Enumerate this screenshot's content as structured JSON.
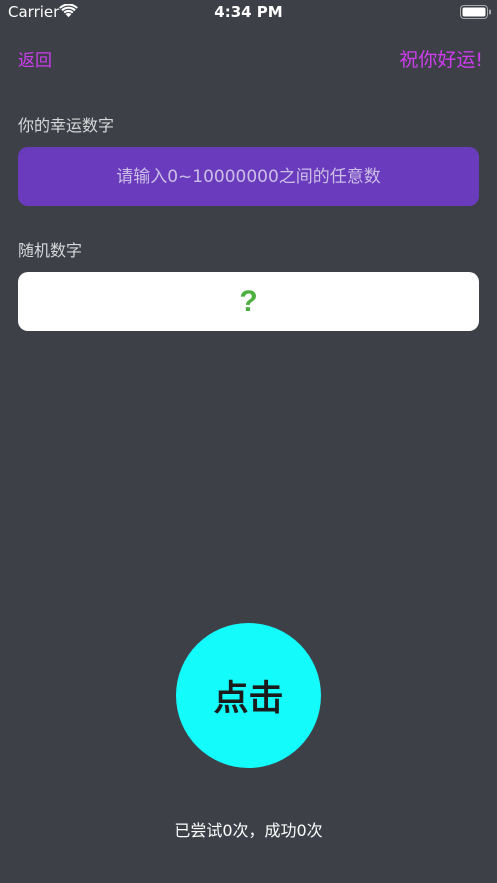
{
  "status_bar": {
    "carrier": "Carrier",
    "time": "4:34 PM",
    "wifi_icon": "wifi-icon",
    "battery_icon": "battery-icon"
  },
  "nav": {
    "back_label": "返回",
    "title": "祝你好运!"
  },
  "lucky_number": {
    "label": "你的幸运数字",
    "placeholder": "请输入0~10000000之间的任意数",
    "value": ""
  },
  "random_number": {
    "label": "随机数字",
    "value": "?"
  },
  "action": {
    "button_label": "点击"
  },
  "stats": {
    "text": "已尝试0次，成功0次"
  },
  "colors": {
    "background": "#3d4047",
    "accent_nav": "#cf3cf0",
    "input_background": "#6a3bbd",
    "random_value": "#4caf3f",
    "button_background": "#14fbfb"
  }
}
